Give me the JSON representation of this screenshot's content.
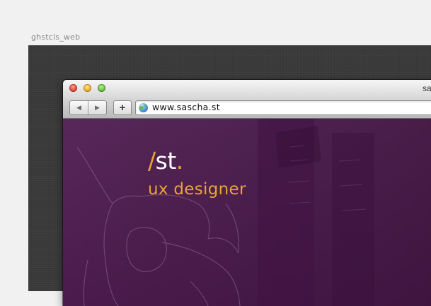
{
  "artboard": {
    "label": "ghstcls_web"
  },
  "browser": {
    "title": "sa",
    "nav": {
      "back_icon": "◀",
      "forward_icon": "▶",
      "add_icon": "+"
    },
    "url": "www.sascha.st"
  },
  "site": {
    "logo_slash": "/",
    "logo_text": "st",
    "logo_dot": ".",
    "tagline": "ux designer"
  },
  "colors": {
    "accent": "#e9a52f",
    "background_purple": "#4e1c50",
    "artboard_dark": "#3a3a3a"
  }
}
